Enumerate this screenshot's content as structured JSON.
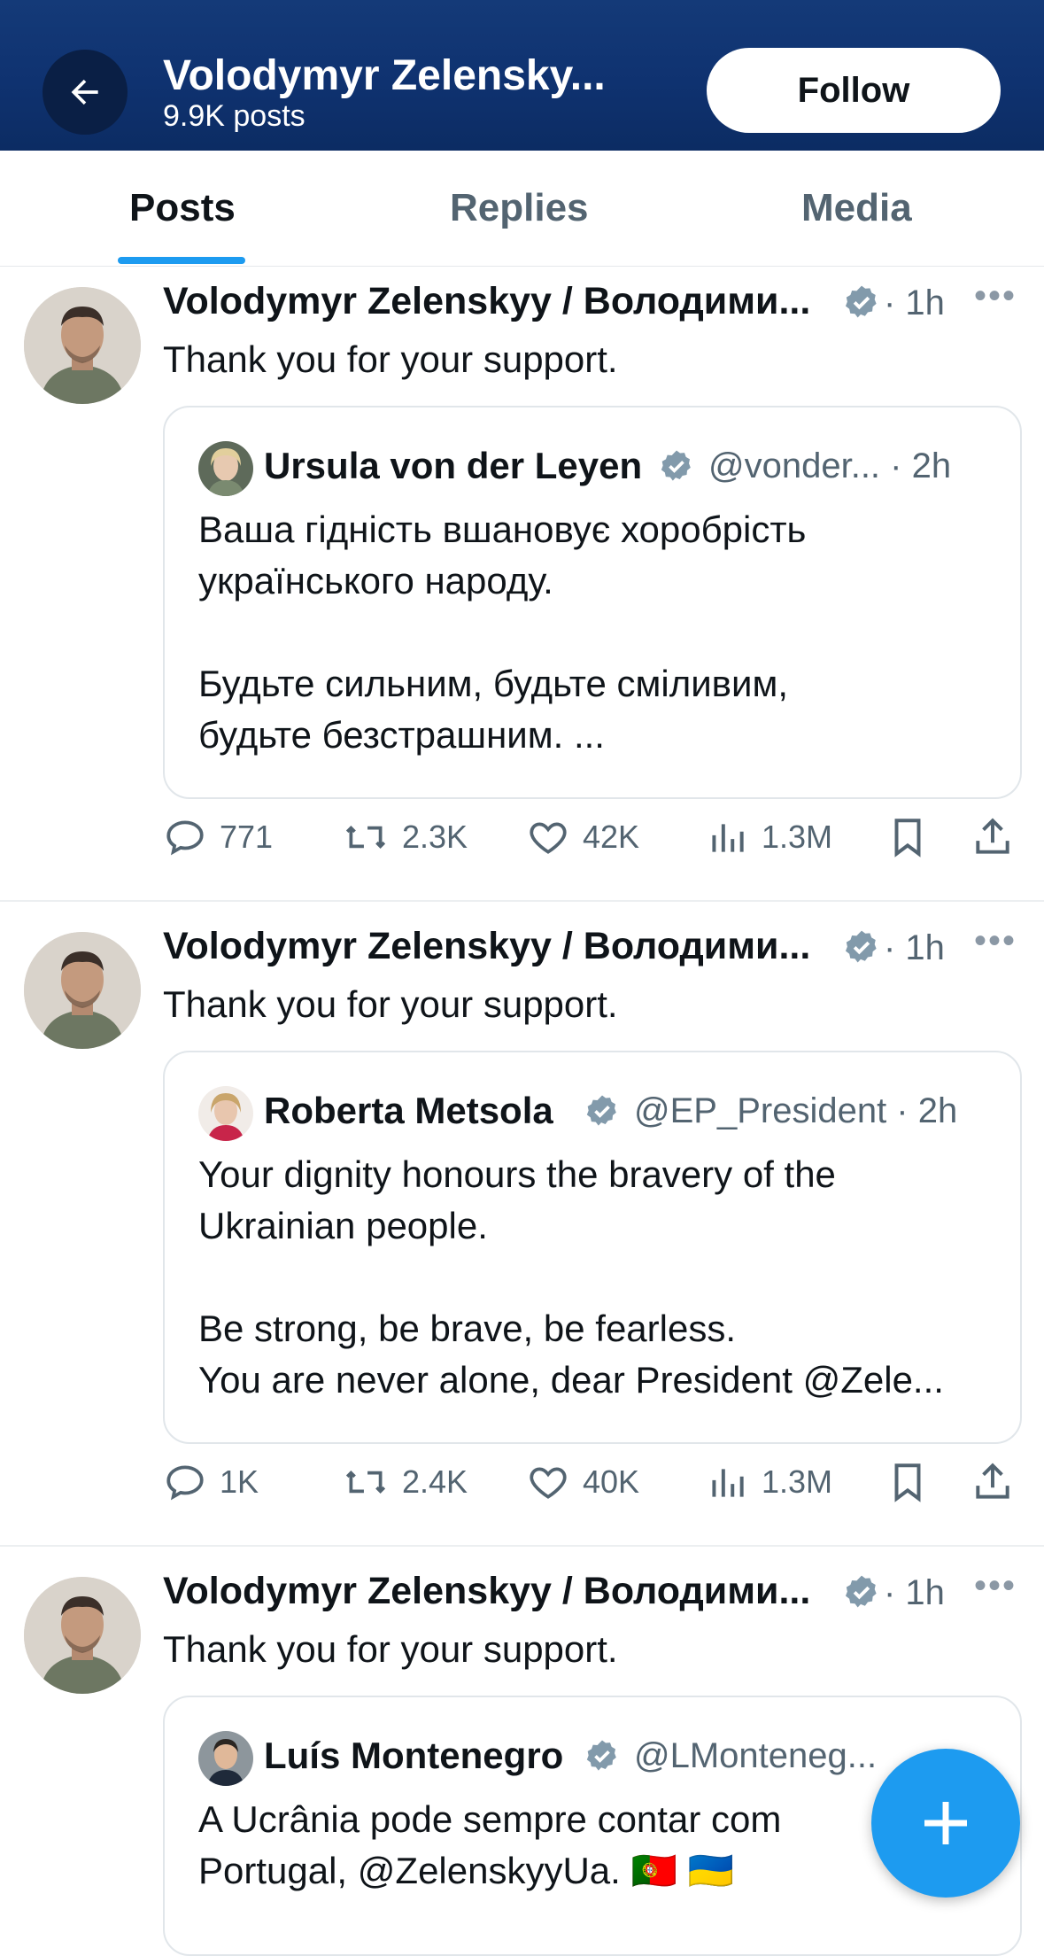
{
  "header": {
    "name": "Volodymyr Zelensky...",
    "posts_count": "9.9K posts",
    "follow_label": "Follow"
  },
  "tabs": [
    {
      "label": "Posts",
      "active": true
    },
    {
      "label": "Replies",
      "active": false
    },
    {
      "label": "Media",
      "active": false
    }
  ],
  "posts": [
    {
      "author": "Volodymyr Zelenskyy / Володими...",
      "time": "· 1h",
      "text": "Thank you for your support.",
      "quote": {
        "author": "Ursula von der Leyen",
        "handle": "@vonder... · 2h",
        "lines": [
          "Ваша гідність вшановує хоробрість",
          "українського народу.",
          "",
          "Будьте сильним, будьте сміливим,",
          "будьте безстрашним. ..."
        ]
      },
      "stats": {
        "replies": "771",
        "reposts": "2.3K",
        "likes": "42K",
        "views": "1.3M"
      }
    },
    {
      "author": "Volodymyr Zelenskyy / Володими...",
      "time": "· 1h",
      "text": "Thank you for your support.",
      "quote": {
        "author": "Roberta Metsola",
        "handle": "@EP_President · 2h",
        "lines": [
          "Your dignity honours the bravery of the",
          "Ukrainian people.",
          "",
          "Be strong, be brave, be fearless.",
          "You are never alone, dear President @Zele..."
        ]
      },
      "stats": {
        "replies": "1K",
        "reposts": "2.4K",
        "likes": "40K",
        "views": "1.3M"
      }
    },
    {
      "author": "Volodymyr Zelenskyy / Володими...",
      "time": "· 1h",
      "text": "Thank you for your support.",
      "quote": {
        "author": "Luís Montenegro",
        "handle": "@LMonteneg...",
        "lines": [
          "A Ucrânia pode sempre contar com",
          "Portugal, @ZelenskyyUa. 🇵🇹 🇺🇦"
        ]
      }
    }
  ],
  "colors": {
    "accent": "#1d9bf0",
    "header_bg": "#0f3270",
    "verified": "#829aab"
  },
  "icons": [
    "back-arrow-icon",
    "verified-icon",
    "more-icon",
    "reply-icon",
    "repost-icon",
    "like-icon",
    "views-icon",
    "bookmark-icon",
    "share-icon",
    "plus-icon"
  ]
}
